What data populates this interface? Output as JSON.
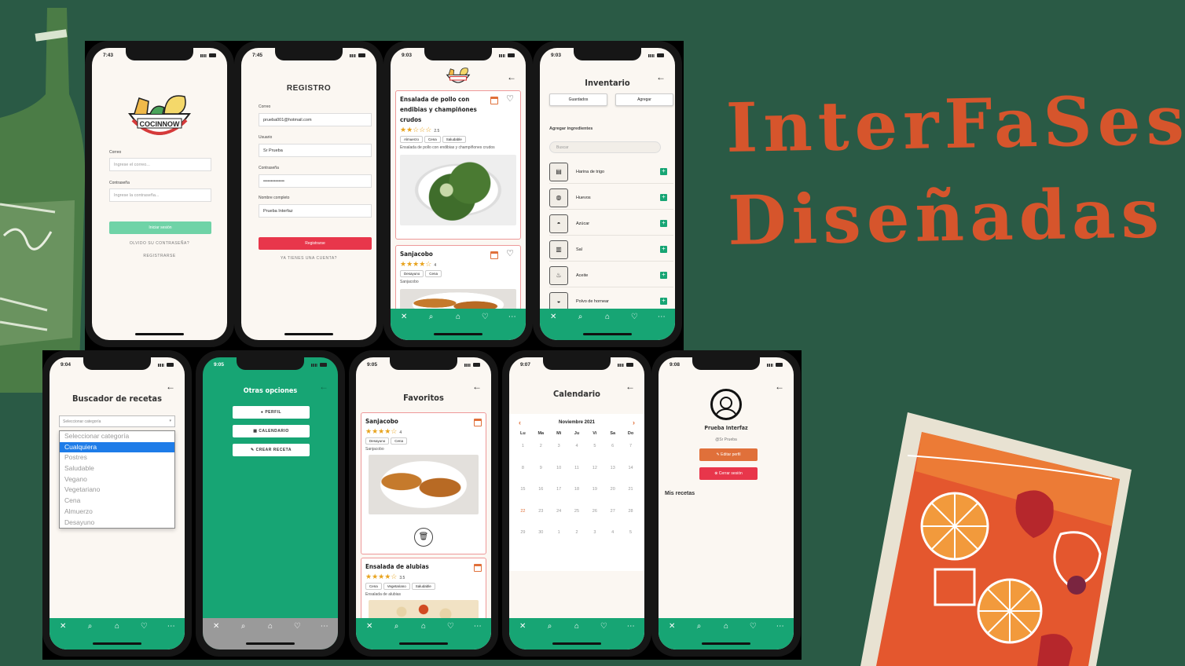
{
  "heading": {
    "line1": "InterFaSes",
    "line2": "Diseñadas"
  },
  "tabbar": [
    "✕",
    "⌕",
    "⌂",
    "♡",
    "⋯"
  ],
  "brand": {
    "green": "#17a574",
    "red": "#e8364b",
    "orange": "#e0703a",
    "cream": "#fbf7f2"
  },
  "login": {
    "time": "7:43",
    "logo_text": "COCINNOW",
    "email_label": "Correo",
    "email_placeholder": "Ingrese el correo...",
    "password_label": "Contraseña",
    "password_placeholder": "Ingrese la contraseña...",
    "login_button": "Iniciar sesión",
    "forgot_link": "OLVIDO SU CONTRASEÑA?",
    "register_link": "REGISTRARSE"
  },
  "register": {
    "time": "7:45",
    "title": "REGISTRO",
    "email_label": "Correo",
    "email_value": "prueba001@hotmail.com",
    "user_label": "Usuario",
    "user_value": "Sr Prueba",
    "password_label": "Contraseña",
    "password_value": "••••••••••••••",
    "name_label": "Nombre completo",
    "name_value": "Prueba Interfaz",
    "register_button": "Registrarse",
    "account_link": "YA TIENES UNA CUENTA?"
  },
  "home": {
    "time": "9:03",
    "recipes": [
      {
        "title": "Ensalada de pollo con endibias y champiñones crudos",
        "stars": "★★☆☆☆",
        "stars_half": "★★★☆☆",
        "rating": "2.5",
        "tags": [
          "Almuerzo",
          "Cena",
          "Saludable"
        ],
        "desc": "Ensalada de pollo con endibias y champiñones crudos"
      },
      {
        "title": "Sanjacobo",
        "stars": "★★★★☆",
        "rating": "4",
        "tags": [
          "Desayuno",
          "Cena"
        ],
        "desc": "Sanjacobo"
      }
    ]
  },
  "inventory": {
    "time": "9:03",
    "title": "Inventario",
    "tab_saved": "Guardados",
    "tab_add": "Agregar",
    "section": "Agregar ingredientes",
    "search_placeholder": "Buscar",
    "items": [
      {
        "name": "Harina de trigo",
        "icon": "flour-bag-icon",
        "glyph": "▤"
      },
      {
        "name": "Huevos",
        "icon": "eggs-icon",
        "glyph": "◍"
      },
      {
        "name": "Azúcar",
        "icon": "sugar-bowl-icon",
        "glyph": "◓"
      },
      {
        "name": "Sal",
        "icon": "salt-shaker-icon",
        "glyph": "▥"
      },
      {
        "name": "Aceite",
        "icon": "oil-bottle-icon",
        "glyph": "♨"
      },
      {
        "name": "Polvo de hornear",
        "icon": "baking-powder-icon",
        "glyph": "◒"
      }
    ]
  },
  "search": {
    "time": "9:04",
    "title": "Buscador de recetas",
    "select_value": "Seleccionar categoría",
    "options": [
      "Seleccionar categoría",
      "Cualquiera",
      "Postres",
      "Saludable",
      "Vegano",
      "Vegetariano",
      "Cena",
      "Almuerzo",
      "Desayuno"
    ],
    "selected_index": 1
  },
  "options": {
    "time": "9:05",
    "title": "Otras opciones",
    "buttons": [
      {
        "label": "PERFIL",
        "icon": "●"
      },
      {
        "label": "CALENDARIO",
        "icon": "▦"
      },
      {
        "label": "CREAR RECETA",
        "icon": "✎"
      }
    ]
  },
  "favorites": {
    "time": "9:05",
    "title": "Favoritos",
    "recipes": [
      {
        "title": "Sanjacobo",
        "stars": "★★★★☆",
        "rating": "4",
        "tags": [
          "Desayuno",
          "Cena"
        ],
        "desc": "Sanjacobo"
      },
      {
        "title": "Ensalada de alubias",
        "stars": "★★★★☆",
        "rating": "3.5",
        "tags": [
          "Cena",
          "Vegetariano",
          "Saludable"
        ],
        "desc": "Ensalada de alubias"
      }
    ],
    "delete_icon": "🗑"
  },
  "calendar": {
    "time": "9:07",
    "title": "Calendario",
    "month": "Noviembre 2021",
    "weekdays": [
      "Lu",
      "Ma",
      "Mi",
      "Ju",
      "Vi",
      "Sa",
      "Do"
    ],
    "days": [
      "1",
      "2",
      "3",
      "4",
      "5",
      "6",
      "7",
      "8",
      "9",
      "10",
      "11",
      "12",
      "13",
      "14",
      "15",
      "16",
      "17",
      "18",
      "19",
      "20",
      "21",
      "22",
      "23",
      "24",
      "25",
      "26",
      "27",
      "28",
      "29",
      "30",
      "1",
      "2",
      "3",
      "4",
      "5"
    ],
    "highlight": [
      "22"
    ]
  },
  "profile": {
    "time": "9:08",
    "name": "Prueba Interfaz",
    "user": "@Sr Prueba",
    "edit_button": "Editar perfil",
    "logout_button": "Cerrar sesión",
    "my_recipes": "Mis recetas"
  }
}
